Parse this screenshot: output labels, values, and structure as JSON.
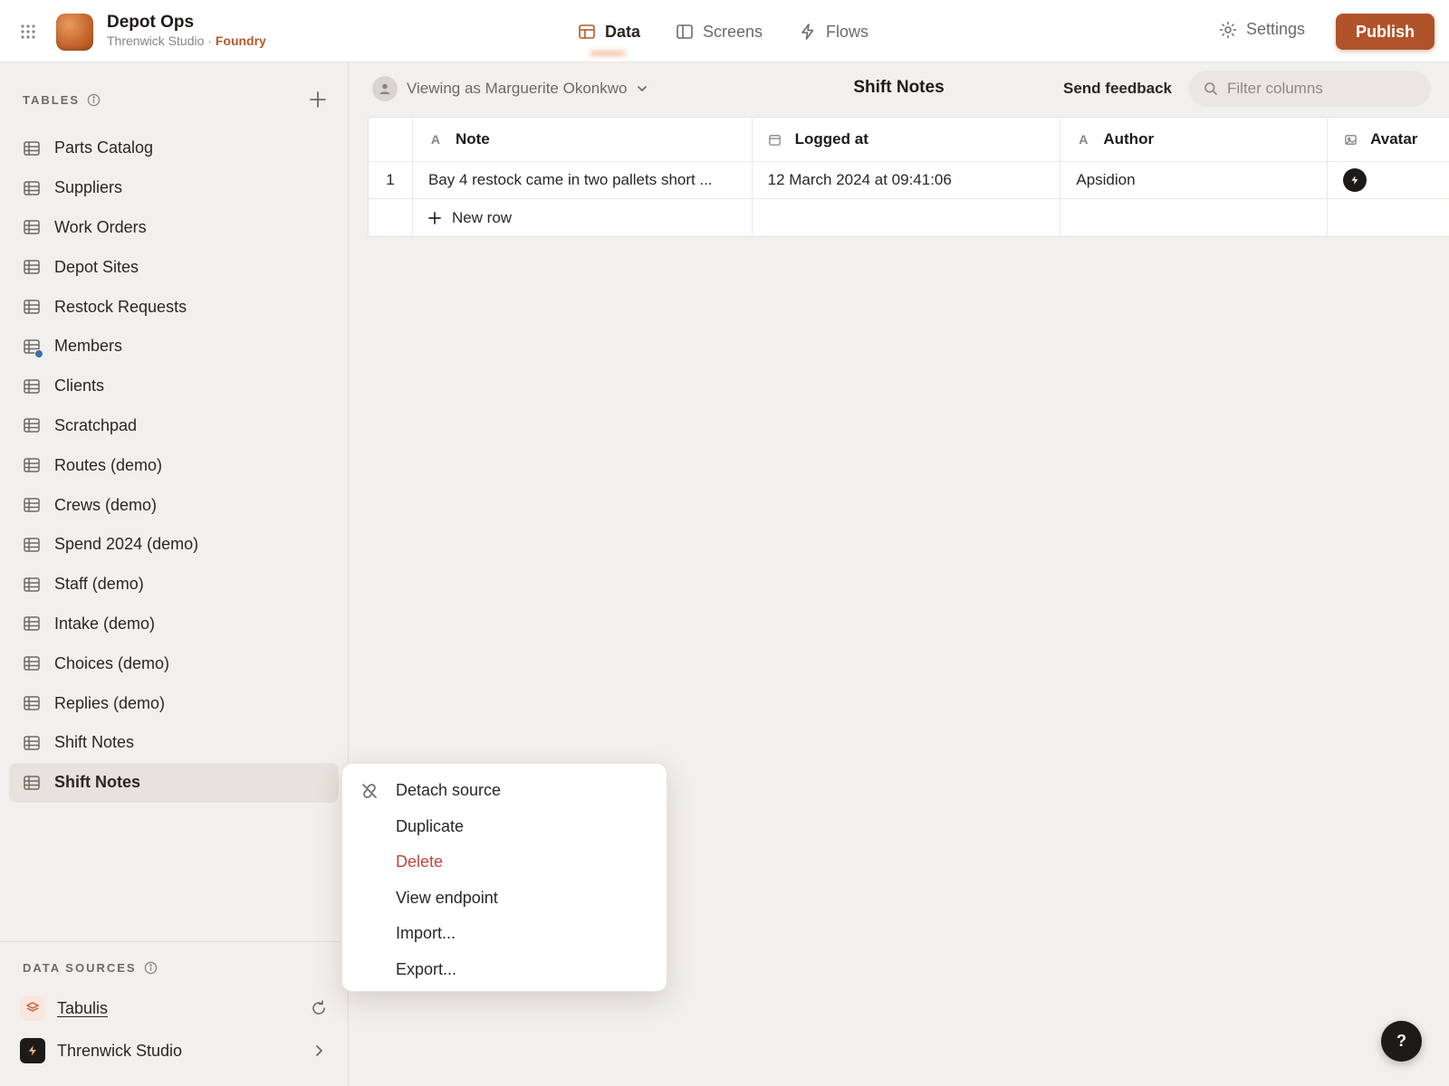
{
  "app": {
    "name": "Depot Ops",
    "workspace": "Threnwick Studio",
    "separator": "·",
    "plan": "Foundry"
  },
  "nav": {
    "tabs": [
      {
        "label": "Data",
        "icon": "table-icon",
        "active": true
      },
      {
        "label": "Screens",
        "icon": "sidebar-layout-icon",
        "active": false
      },
      {
        "label": "Flows",
        "icon": "bolt-icon",
        "active": false
      }
    ],
    "settings_label": "Settings",
    "publish_label": "Publish"
  },
  "colors": {
    "accent": "#b0532a",
    "danger": "#c0463a",
    "sidebar_bg": "#f2f0ee",
    "member_dot": "#3a72a8"
  },
  "sidebar": {
    "tables_heading": "TABLES",
    "tables": [
      {
        "label": "Parts Catalog"
      },
      {
        "label": "Suppliers"
      },
      {
        "label": "Work Orders"
      },
      {
        "label": "Depot Sites"
      },
      {
        "label": "Restock Requests"
      },
      {
        "label": "Members",
        "badge": true
      },
      {
        "label": "Clients"
      },
      {
        "label": "Scratchpad"
      },
      {
        "label": "Routes (demo)"
      },
      {
        "label": "Crews (demo)"
      },
      {
        "label": "Spend 2024 (demo)"
      },
      {
        "label": "Staff (demo)"
      },
      {
        "label": "Intake (demo)"
      },
      {
        "label": "Choices (demo)"
      },
      {
        "label": "Replies (demo)"
      },
      {
        "label": "Shift Notes"
      },
      {
        "label": "Shift Notes",
        "selected": true
      }
    ],
    "sources_heading": "DATA SOURCES",
    "sources": [
      {
        "label": "Tabulis",
        "icon": "layers-icon",
        "trailing": "refresh-icon"
      },
      {
        "label": "Threnwick Studio",
        "icon": "bolt-icon",
        "trailing": "chevron-right-icon"
      }
    ]
  },
  "main": {
    "viewing_as": "Viewing as Marguerite Okonkwo",
    "title": "Shift Notes",
    "feedback_label": "Send feedback",
    "filter_placeholder": "Filter columns",
    "columns": [
      {
        "label": "Note",
        "icon": "A"
      },
      {
        "label": "Logged at",
        "icon": "calendar-icon"
      },
      {
        "label": "Author",
        "icon": "A"
      },
      {
        "label": "Avatar",
        "icon": "image-icon"
      }
    ],
    "rows": [
      {
        "index": "1",
        "note": "Bay 4 restock came in two pallets short ...",
        "logged_at": "12 March 2024 at 09:41:06",
        "author": "Apsidion",
        "avatar": "bolt-icon"
      }
    ],
    "new_row_label": "New row"
  },
  "context_menu": {
    "items": [
      {
        "label": "Detach source",
        "icon": "link-off-icon"
      },
      {
        "label": "Duplicate"
      },
      {
        "label": "Delete",
        "danger": true
      },
      {
        "label": "View endpoint"
      },
      {
        "label": "Import..."
      },
      {
        "label": "Export..."
      }
    ]
  },
  "help": {
    "label": "?"
  }
}
